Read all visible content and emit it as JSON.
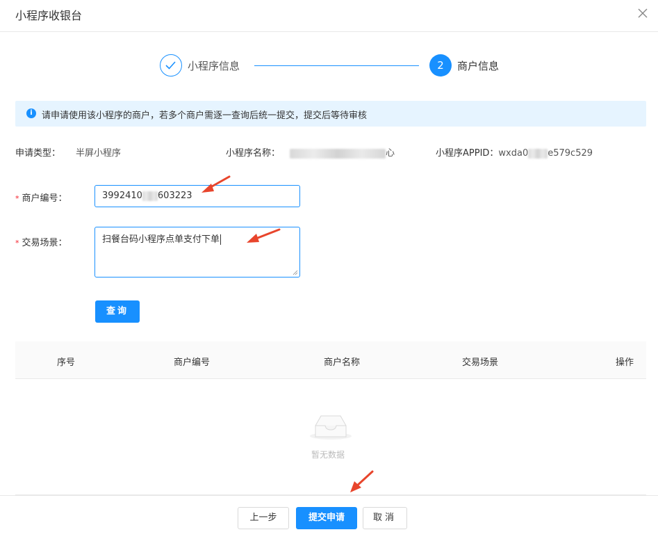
{
  "dialog": {
    "title": "小程序收银台"
  },
  "steps": [
    {
      "label": "小程序信息",
      "status": "done"
    },
    {
      "number": "2",
      "label": "商户信息",
      "status": "active"
    }
  ],
  "alert": {
    "icon": "info-icon",
    "text": "请申请使用该小程序的商户，若多个商户需逐一查询后统一提交，提交后等待审核"
  },
  "info": {
    "type_label": "申请类型：",
    "type_value": "半屏小程序",
    "name_label": "小程序名称：",
    "name_value_visible_tail": "心",
    "appid_label": "小程序APPID：",
    "appid_prefix": "wxda0",
    "appid_suffix": "e579c529"
  },
  "form": {
    "merchant_no_label": "商户编号：",
    "merchant_no_prefix": "3992410",
    "merchant_no_suffix": "603223",
    "scene_label": "交易场景：",
    "scene_value": "扫餐台码小程序点单支付下单",
    "query_button": "查询"
  },
  "table": {
    "columns": [
      "序号",
      "商户编号",
      "商户名称",
      "交易场景",
      "操作"
    ],
    "rows": [],
    "empty_text": "暂无数据"
  },
  "footer": {
    "prev_button": "上一步",
    "submit_button": "提交申请",
    "cancel_button": "取消"
  },
  "colors": {
    "primary": "#1890ff",
    "alert_bg": "#e6f4ff",
    "required": "#f5222d",
    "annotation_arrow": "#e8452c"
  }
}
